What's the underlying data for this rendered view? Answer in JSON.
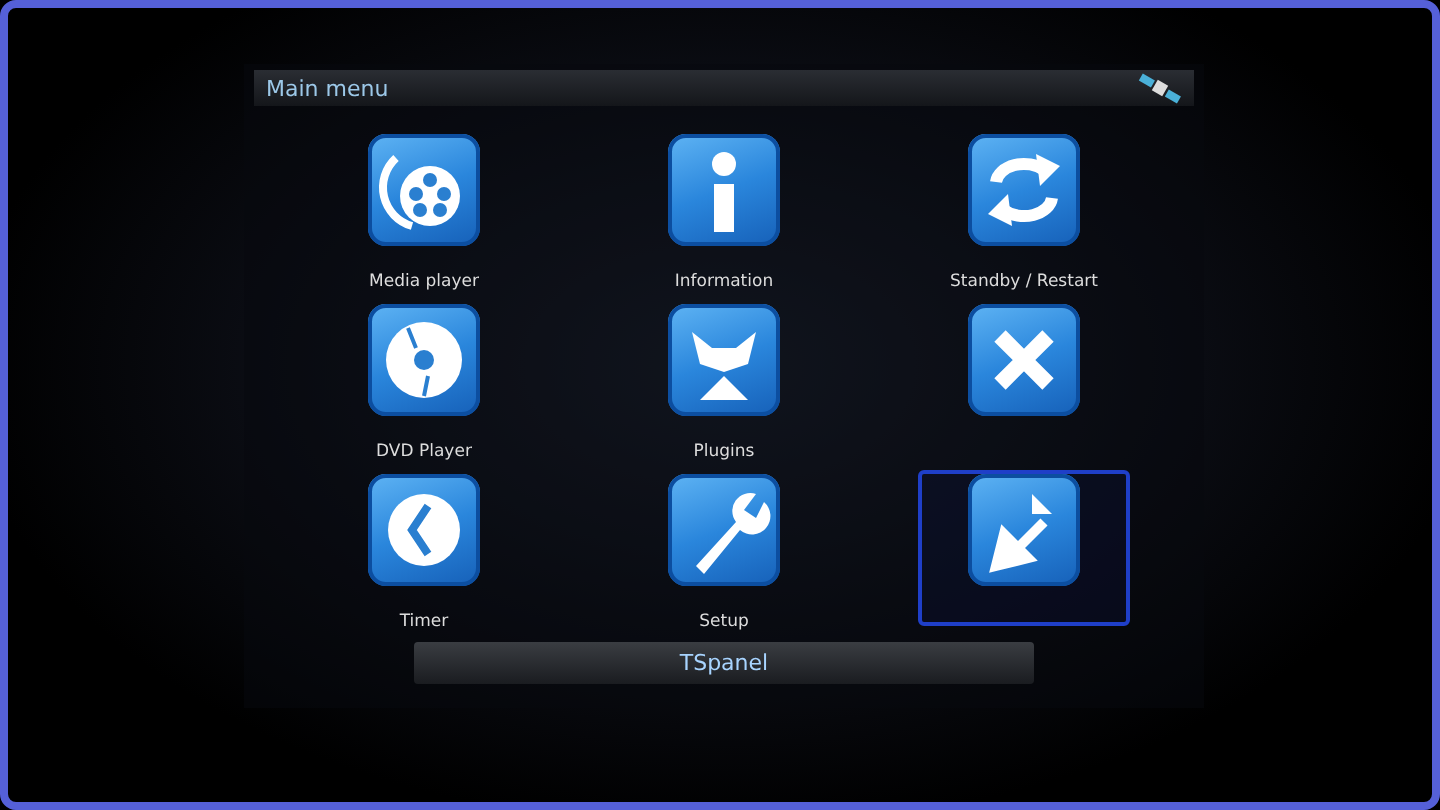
{
  "window": {
    "title": "Main menu"
  },
  "items": [
    {
      "kind": "film",
      "label": "Media player",
      "selected": false
    },
    {
      "kind": "info",
      "label": "Information",
      "selected": false
    },
    {
      "kind": "refresh",
      "label": "Standby / Restart",
      "selected": false
    },
    {
      "kind": "disc",
      "label": "DVD Player",
      "selected": false
    },
    {
      "kind": "plug",
      "label": "Plugins",
      "selected": false
    },
    {
      "kind": "close",
      "selected": false
    },
    {
      "kind": "clock",
      "label": "Timer",
      "selected": false
    },
    {
      "kind": "wrench",
      "label": "Setup",
      "selected": false
    },
    {
      "kind": "arrow",
      "selected": true
    }
  ],
  "status_bar": {
    "text": "TSpanel"
  }
}
